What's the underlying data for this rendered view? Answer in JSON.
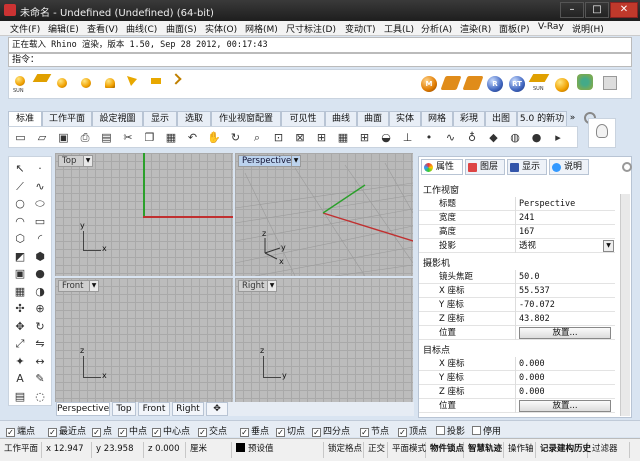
{
  "window": {
    "title": "未命名 - Undefined (Undefined) (64-bit)",
    "min": "–",
    "max": "□",
    "close": "✕"
  },
  "menu": [
    "文件(F)",
    "编辑(E)",
    "查看(V)",
    "曲线(C)",
    "曲面(S)",
    "实体(O)",
    "网格(M)",
    "尺寸标注(D)",
    "变动(T)",
    "工具(L)",
    "分析(A)",
    "渲染(R)",
    "面板(P)",
    "V-Ray",
    "说明(H)"
  ],
  "command": {
    "history": "正在载入 Rhino 渲染，版本 1.50, Sep 28 2012, 00:17:43",
    "prompt": "指令："
  },
  "render_toolbar": {
    "sun_label": "SUN",
    "right_labels": [
      "M",
      "",
      "R",
      "RT",
      "SUN",
      ""
    ]
  },
  "tabs": [
    "标准",
    "工作平面",
    "設定視圖",
    "显示",
    "选取",
    "作业视窗配置",
    "可见性",
    "曲线",
    "曲面",
    "实体",
    "网格",
    "彩現",
    "出图",
    "5.0 的新功"
  ],
  "tabs_more": "»",
  "main_icons": [
    "new-file-icon",
    "open-file-icon",
    "save-icon",
    "print-icon",
    "import-icon",
    "cut-icon",
    "copy-icon",
    "paste-icon",
    "undo-icon",
    "pan-hand-icon",
    "rotate-view-icon",
    "zoom-icon",
    "zoom-window-icon",
    "zoom-extents-icon",
    "zoom-selected-icon",
    "grid-view-icon",
    "four-view-icon",
    "car-icon",
    "cplane-icon",
    "point-icon",
    "curve-icon",
    "lamp-icon",
    "material-icon",
    "color-wheel-icon",
    "sphere-icon",
    "more-icon"
  ],
  "viewports": {
    "top": {
      "label": "Top",
      "axis_x": "x",
      "axis_y": "y"
    },
    "perspective": {
      "label": "Perspective",
      "axis_x": "x",
      "axis_y": "y",
      "axis_z": "z"
    },
    "front": {
      "label": "Front",
      "axis_x": "x",
      "axis_z": "z"
    },
    "right": {
      "label": "Right",
      "axis_y": "y",
      "axis_z": "z"
    }
  },
  "viewport_tabs": [
    "Perspective",
    "Top",
    "Front",
    "Right"
  ],
  "viewport_tabs_add": "✥",
  "properties": {
    "tabs": [
      "属性",
      "图层",
      "显示",
      "说明"
    ],
    "section_viewport": "工作视窗",
    "title_k": "标题",
    "title_v": "Perspective",
    "width_k": "宽度",
    "width_v": "241",
    "height_k": "高度",
    "height_v": "167",
    "proj_k": "投影",
    "proj_v": "透视",
    "section_camera": "摄影机",
    "lens_k": "镜头焦距",
    "lens_v": "50.0",
    "cx_k": "X 座标",
    "cx_v": "55.537",
    "cy_k": "Y 座标",
    "cy_v": "-70.072",
    "cz_k": "Z 座标",
    "cz_v": "43.802",
    "cpos_k": "位置",
    "place_btn": "放置...",
    "section_target": "目标点",
    "tx_k": "X 座标",
    "tx_v": "0.000",
    "ty_k": "Y 座标",
    "ty_v": "0.000",
    "tz_k": "Z 座标",
    "tz_v": "0.000",
    "tpos_k": "位置",
    "place_btn2": "放置..."
  },
  "osnap": [
    {
      "label": "端点",
      "checked": true
    },
    {
      "label": "最近点",
      "checked": true
    },
    {
      "label": "点",
      "checked": true
    },
    {
      "label": "中点",
      "checked": true
    },
    {
      "label": "中心点",
      "checked": true
    },
    {
      "label": "交点",
      "checked": true
    },
    {
      "label": "垂点",
      "checked": true
    },
    {
      "label": "切点",
      "checked": true
    },
    {
      "label": "四分点",
      "checked": true
    },
    {
      "label": "节点",
      "checked": true
    },
    {
      "label": "顶点",
      "checked": true
    },
    {
      "label": "投影",
      "checked": false
    },
    {
      "label": "停用",
      "checked": false
    }
  ],
  "status": {
    "cplane": "工作平面",
    "x": "x 12.947",
    "y": "y 23.958",
    "z": "z 0.000",
    "unit": "厘米",
    "layer": "预设值",
    "grid_snap": "锁定格点",
    "ortho": "正交",
    "planar": "平面模式",
    "osnap": "物件锁点",
    "smart": "智慧轨迹",
    "gumball": "操作轴",
    "record": "记录建构历史",
    "filter": "过滤器"
  }
}
